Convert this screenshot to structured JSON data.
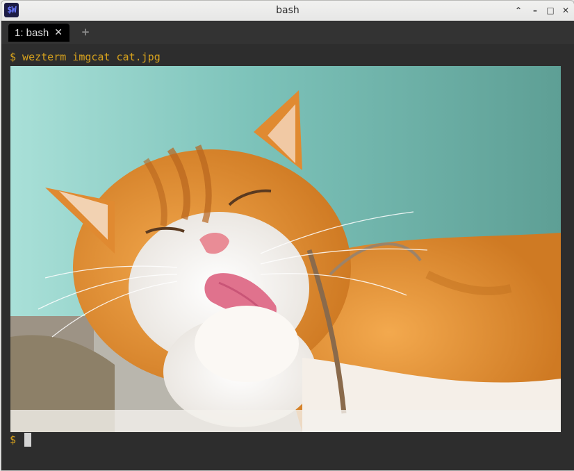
{
  "window": {
    "title": "bash",
    "app_icon_text": "$W",
    "controls": {
      "minimize": "–",
      "maximize": "□",
      "close": "✕",
      "collapse": "⌃"
    }
  },
  "tabs": [
    {
      "label": "1: bash",
      "close": "✕"
    }
  ],
  "new_tab_label": "+",
  "terminal": {
    "command_line": "$ wezterm imgcat cat.jpg",
    "prompt": "$ ",
    "image": "orange-white-cat-licking-paw"
  },
  "colors": {
    "prompt_text": "#d7a21d",
    "terminal_bg": "#2d2d2d",
    "tab_bg": "#000000",
    "cursor": "#d4d4d4"
  }
}
